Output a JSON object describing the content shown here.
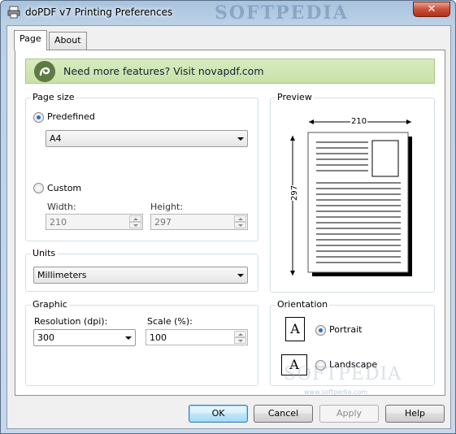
{
  "window": {
    "title": "doPDF v7 Printing Preferences",
    "watermark": "SOFTPEDIA",
    "close_label": "✕"
  },
  "tabs": [
    {
      "label": "Page",
      "active": true
    },
    {
      "label": "About",
      "active": false
    }
  ],
  "banner": {
    "text": "Need more features? Visit novapdf.com"
  },
  "page_size": {
    "label": "Page size",
    "predefined_label": "Predefined",
    "predefined_selected": true,
    "size_value": "A4",
    "custom_label": "Custom",
    "width_label": "Width:",
    "height_label": "Height:",
    "width_value": "210",
    "height_value": "297"
  },
  "units": {
    "label": "Units",
    "value": "Millimeters"
  },
  "graphic": {
    "label": "Graphic",
    "resolution_label": "Resolution (dpi):",
    "resolution_value": "300",
    "scale_label": "Scale (%):",
    "scale_value": "100"
  },
  "preview": {
    "label": "Preview",
    "width_dim": "210",
    "height_dim": "297"
  },
  "orientation": {
    "label": "Orientation",
    "portrait_label": "Portrait",
    "landscape_label": "Landscape",
    "selected": "portrait",
    "icon_letter": "A"
  },
  "watermark_center": {
    "main": "SOFTPEDIA",
    "sub": "www.softpedia.com"
  },
  "buttons": {
    "ok": "OK",
    "cancel": "Cancel",
    "apply": "Apply",
    "help": "Help"
  },
  "colors": {
    "accent": "#2a6fc9",
    "banner": "#c8e1a8",
    "close": "#c7503a"
  }
}
